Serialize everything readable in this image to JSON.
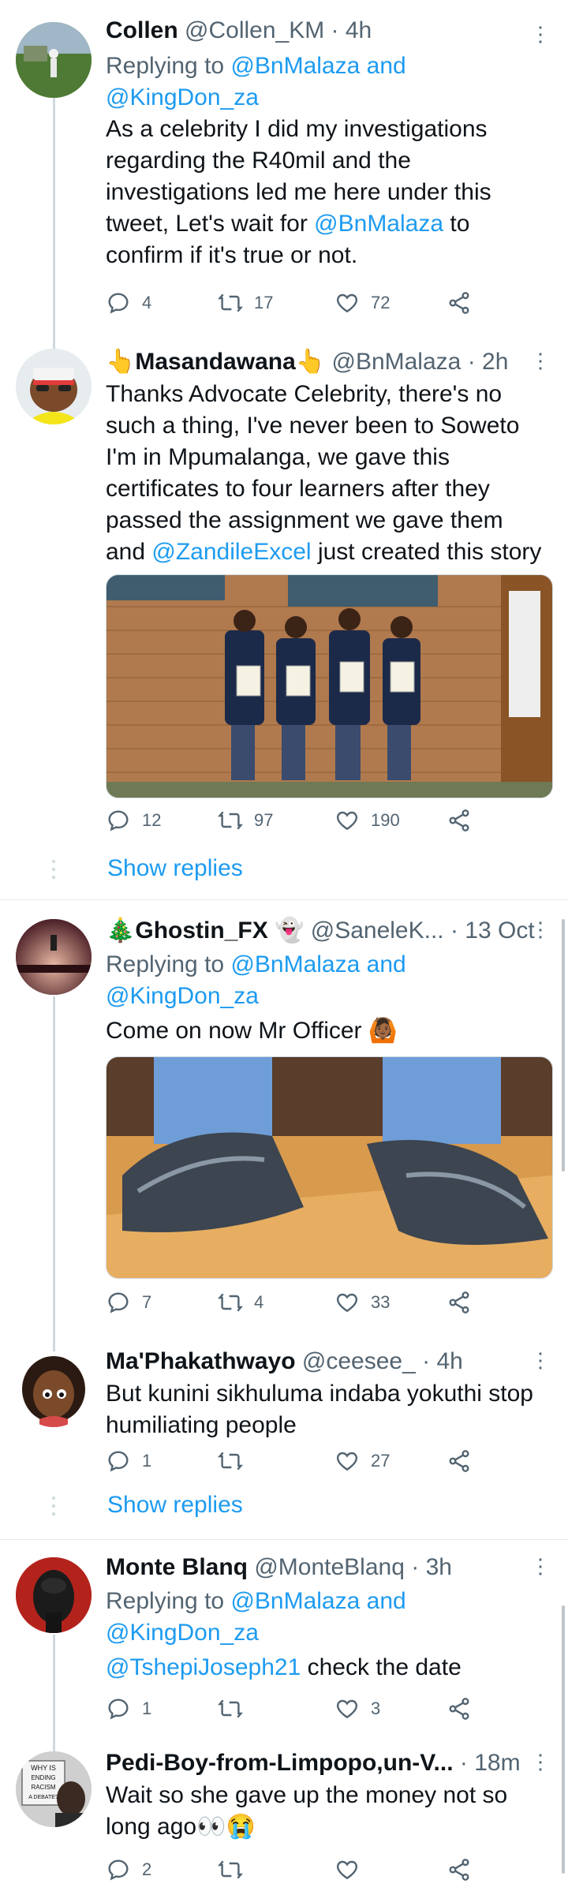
{
  "tweets": [
    {
      "name": "Collen",
      "handle": "@Collen_KM",
      "time": "· 4h",
      "replying_prefix": "Replying to ",
      "replying_to_1": "@BnMalaza",
      "replying_and": " and",
      "replying_to_2": "@KingDon_za",
      "text_1": "As a celebrity I did my investigations regarding the R40mil and the investigations led me here under this tweet, Let's wait for ",
      "text_link": "@BnMalaza",
      "text_2": " to confirm if it's true or not.",
      "replies": "4",
      "retweets": "17",
      "likes": "72"
    },
    {
      "name_emoji_left": "👆",
      "name": "Masandawana",
      "name_emoji_right": "👆",
      "handle": "@BnMalaza",
      "time": "· 2h",
      "text_1": "Thanks Advocate Celebrity, there's no such a thing, I've never been to Soweto I'm in Mpumalanga, we gave this certificates to four learners after they passed the assignment we gave them and ",
      "text_link": "@ZandileExcel",
      "text_2": " just created this story",
      "replies": "12",
      "retweets": "97",
      "likes": "190",
      "show_replies": "Show replies"
    },
    {
      "name_emoji_left": "🎄",
      "name": "Ghostin_FX",
      "name_emoji_right": "👻",
      "handle": "@SaneleK...",
      "time": "· 13 Oct",
      "replying_prefix": "Replying to ",
      "replying_to_1": "@BnMalaza",
      "replying_and": " and",
      "replying_to_2": "@KingDon_za",
      "text_1": "Come on now Mr Officer ",
      "text_emoji": "🙆🏾",
      "replies": "7",
      "retweets": "4",
      "likes": "33"
    },
    {
      "name": "Ma'Phakathwayo",
      "handle": "@ceesee_",
      "time": "· 4h",
      "text_1": "But kunini sikhuluma indaba yokuthi stop humiliating people",
      "replies": "1",
      "retweets": "",
      "likes": "27",
      "show_replies": "Show replies"
    },
    {
      "name": "Monte Blanq",
      "handle": "@MonteBlanq",
      "time": "· 3h",
      "replying_prefix": "Replying to ",
      "replying_to_1": "@BnMalaza",
      "replying_and": " and",
      "replying_to_2": "@KingDon_za",
      "text_link": "@TshepiJoseph21",
      "text_2": " check the date",
      "replies": "1",
      "retweets": "",
      "likes": "3"
    },
    {
      "name": "Pedi-Boy-from-Limpopo,un-V...",
      "handle": "",
      "time": "· 18m",
      "text_1": "Wait so she gave up the money not so long ago",
      "text_emoji": "👀😭",
      "replies": "2",
      "retweets": "",
      "likes": "",
      "avatar_sign": [
        "WHY IS",
        "ENDING",
        "RACISM",
        "A DEBATE?"
      ]
    }
  ],
  "icons": {
    "reply": "reply-icon",
    "retweet": "retweet-icon",
    "like": "heart-icon",
    "share": "share-icon",
    "more": "more-icon"
  },
  "colors": {
    "link": "#1d9bf0",
    "secondary": "#536471",
    "text": "#0f1419"
  }
}
